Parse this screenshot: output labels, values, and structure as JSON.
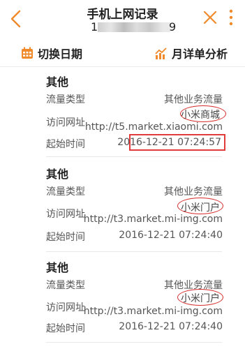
{
  "header": {
    "title": "手机上网记录",
    "phone_prefix": "1",
    "phone_suffix": "9"
  },
  "toolbar": {
    "switch_date_label": "切换日期",
    "monthly_analysis_label": "月详单分析"
  },
  "labels": {
    "traffic_type": "流量类型",
    "visit_url": "访问网址",
    "start_time": "起始时间"
  },
  "records": [
    {
      "category": "其他",
      "traffic_type": "其他业务流量",
      "site_name": "小米商城",
      "url": "http://t5.market.xiaomi.com",
      "start_time": "2016-12-21 07:24:57"
    },
    {
      "category": "其他",
      "traffic_type": "其他业务流量",
      "site_name": "小米门户",
      "url": "http://t3.market.mi-img.com",
      "start_time": "2016-12-21 07:24:40"
    },
    {
      "category": "其他",
      "traffic_type": "其他业务流量",
      "site_name": "小米门户",
      "url": "http://t3.market.mi-img.com",
      "start_time": "2016-12-21 07:24:40"
    }
  ],
  "colors": {
    "accent": "#f08a2a",
    "highlight_red": "#e23b3b"
  }
}
